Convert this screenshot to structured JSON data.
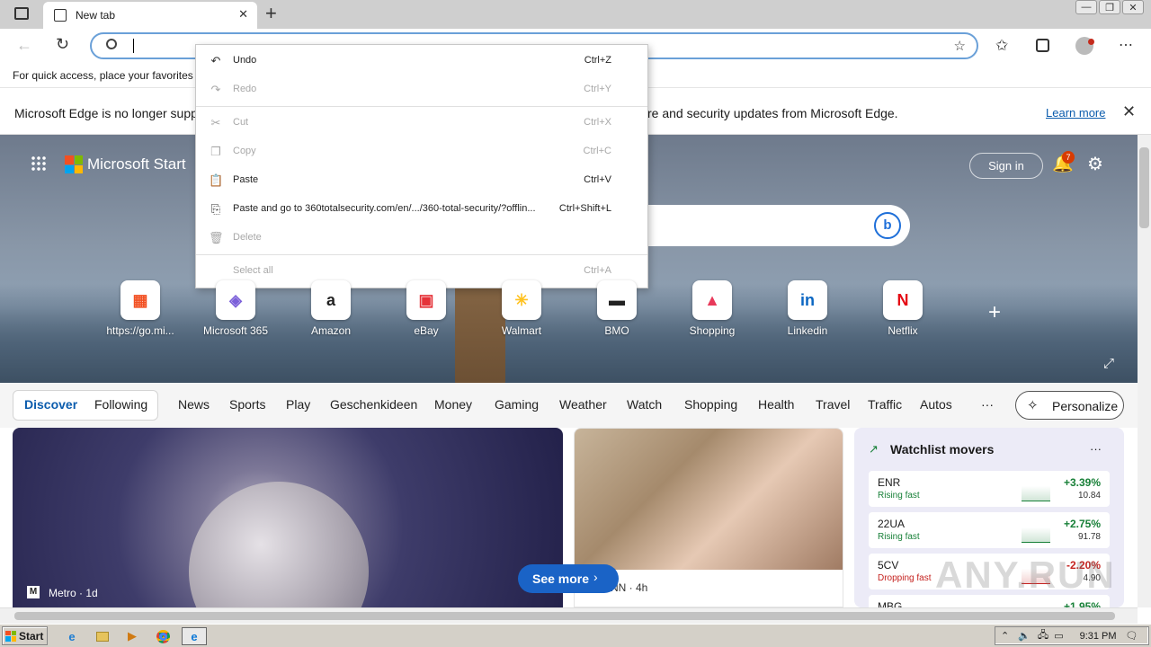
{
  "browser": {
    "tab_title": "New tab",
    "tab_close": "✕",
    "new_tab": "+",
    "address_value": "",
    "fav_bar_text": "For quick access, place your favorites h",
    "window_controls": [
      "—",
      "❐",
      "✕"
    ]
  },
  "infobar": {
    "text_left": "Microsoft Edge is no longer suppo",
    "text_right": "re and security updates from Microsoft Edge.",
    "learn_more": "Learn more"
  },
  "start_page": {
    "brand": "Microsoft Start",
    "sign_in": "Sign in",
    "notif_count": "7",
    "tiles": [
      {
        "label": "https://go.mi...",
        "glyph": "▦",
        "color": "#f25022"
      },
      {
        "label": "Microsoft 365",
        "glyph": "◈",
        "color": "#7b5fd9"
      },
      {
        "label": "Amazon",
        "glyph": "a",
        "color": "#ffffff"
      },
      {
        "label": "eBay",
        "glyph": "▣",
        "color": "#e53238"
      },
      {
        "label": "Walmart",
        "glyph": "✳",
        "color": "#ffc220"
      },
      {
        "label": "BMO",
        "glyph": "▬",
        "color": "#ffffff"
      },
      {
        "label": "Shopping",
        "glyph": "▲",
        "color": "#e8395a"
      },
      {
        "label": "Linkedin",
        "glyph": "in",
        "color": "#0a66c2"
      },
      {
        "label": "Netflix",
        "glyph": "N",
        "color": "#e50914"
      }
    ],
    "add_tile": "+",
    "nav_left": [
      "Discover",
      "Following"
    ],
    "nav_items": [
      "News",
      "Sports",
      "Play",
      "Geschenkideen",
      "Money",
      "Gaming",
      "Weather",
      "Watch",
      "Shopping",
      "Health",
      "Travel",
      "Traffic",
      "Autos"
    ],
    "more": "···",
    "personalize": "Personalize",
    "card1_source": "Metro · 1d",
    "card2_source": "NN · 4h",
    "see_more": "See more"
  },
  "watchlist": {
    "title": "Watchlist movers",
    "menu": "···",
    "rows": [
      {
        "symbol": "ENR",
        "status": "Rising fast",
        "pct": "+3.39%",
        "price": "10.84",
        "color": "#188038"
      },
      {
        "symbol": "22UA",
        "status": "Rising fast",
        "pct": "+2.75%",
        "price": "91.78",
        "color": "#188038"
      },
      {
        "symbol": "5CV",
        "status": "Dropping fast",
        "pct": "-2.20%",
        "price": "4.90",
        "color": "#c5221f"
      },
      {
        "symbol": "MBG",
        "status": "",
        "pct": "+1.95%",
        "price": "",
        "color": "#188038"
      }
    ]
  },
  "context_menu": {
    "items": [
      {
        "label": "Undo",
        "shortcut": "Ctrl+Z",
        "icon": "↶",
        "enabled": true
      },
      {
        "label": "Redo",
        "shortcut": "Ctrl+Y",
        "icon": "↷",
        "enabled": false
      },
      {
        "label": "Cut",
        "shortcut": "Ctrl+X",
        "icon": "✂",
        "enabled": false
      },
      {
        "label": "Copy",
        "shortcut": "Ctrl+C",
        "icon": "❐",
        "enabled": false
      },
      {
        "label": "Paste",
        "shortcut": "Ctrl+V",
        "icon": "📋",
        "enabled": true
      },
      {
        "label": "Paste and go to 360totalsecurity.com/en/.../360-total-security/?offlin...",
        "shortcut": "Ctrl+Shift+L",
        "icon": "⎘",
        "enabled": true
      },
      {
        "label": "Delete",
        "shortcut": "",
        "icon": "🗑",
        "enabled": false
      },
      {
        "label": "Select all",
        "shortcut": "Ctrl+A",
        "icon": "",
        "enabled": false
      }
    ]
  },
  "taskbar": {
    "start": "Start",
    "clock": "9:31 PM"
  },
  "watermark": "ANY.RUN"
}
